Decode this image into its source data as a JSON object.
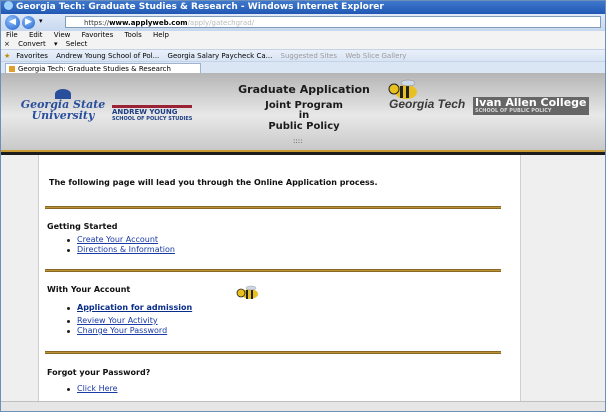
{
  "window": {
    "title": "Georgia Tech: Graduate Studies & Research - Windows Internet Explorer"
  },
  "address": {
    "prefix": "https://",
    "host": "www.applyweb.com",
    "path": "/apply/gatechgrad/"
  },
  "menu": {
    "items": [
      "File",
      "Edit",
      "View",
      "Favorites",
      "Tools",
      "Help"
    ]
  },
  "convert": {
    "convert_label": "Convert",
    "select_label": "Select"
  },
  "favorites": {
    "label": "Favorites",
    "items": [
      "Andrew Young School of Pol...",
      "Georgia Salary Paycheck Ca...",
      "Suggested Sites",
      "Web Slice Gallery"
    ]
  },
  "tab": {
    "label": "Georgia Tech: Graduate Studies & Research"
  },
  "banner": {
    "left_logo_line1": "Georgia State",
    "left_logo_line2": "University",
    "andrew_young": "ANDREW YOUNG",
    "andrew_young_sub": "SCHOOL OF POLICY STUDIES",
    "title1": "Graduate Application",
    "title2": "Joint Program",
    "title3": "in",
    "title4": "Public Policy",
    "georgia_tech": "Georgia Tech",
    "ivan_allen": "Ivan Allen College",
    "ivan_allen_sub": "SCHOOL OF PUBLIC POLICY",
    "dots": "::::"
  },
  "content": {
    "intro": "The following page will lead you through the Online Application process.",
    "getting_started": {
      "heading": "Getting Started",
      "links": [
        "Create Your Account",
        "Directions & Information"
      ]
    },
    "with_account": {
      "heading": "With Your Account",
      "links": [
        "Application for admission",
        "Review Your Activity",
        "Change Your Password"
      ]
    },
    "forgot": {
      "heading": "Forgot your Password?",
      "links": [
        "Click Here"
      ]
    }
  },
  "colors": {
    "gold": "#caa23c",
    "link": "#1a3aa5",
    "titlebar": "#2157b3"
  }
}
